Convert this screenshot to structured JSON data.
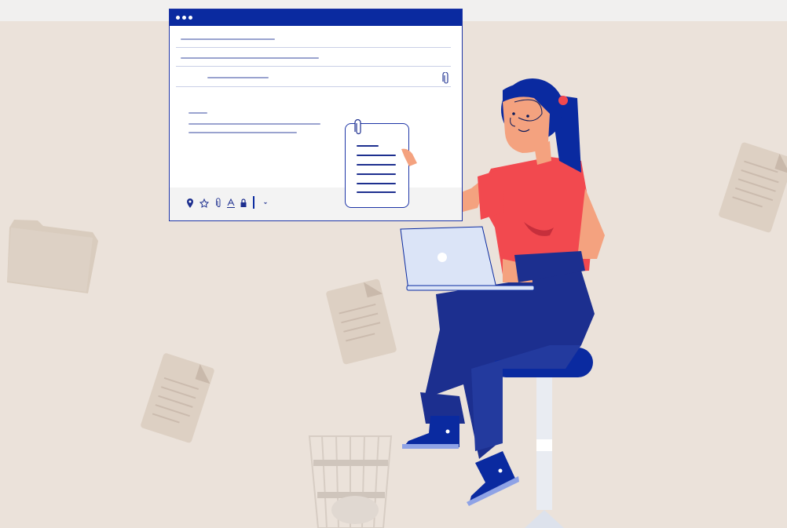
{
  "colors": {
    "background": "#ebe2da",
    "accent": "#0a2aa0",
    "shirt": "#f2494f",
    "pants": "#1c2f8f",
    "laptop": "#dbe4f7"
  },
  "email_window": {
    "icons": [
      "titlebar-dots-icon",
      "attachment-icon"
    ],
    "toolbar_icons": [
      "location-pin-icon",
      "star-icon",
      "paperclip-icon",
      "text-format-icon",
      "lock-icon",
      "send-divider",
      "chevron-down-icon"
    ]
  },
  "illustration": {
    "items": [
      "woman-with-laptop",
      "attached-document",
      "folder",
      "documents",
      "waste-basket",
      "stool"
    ]
  }
}
